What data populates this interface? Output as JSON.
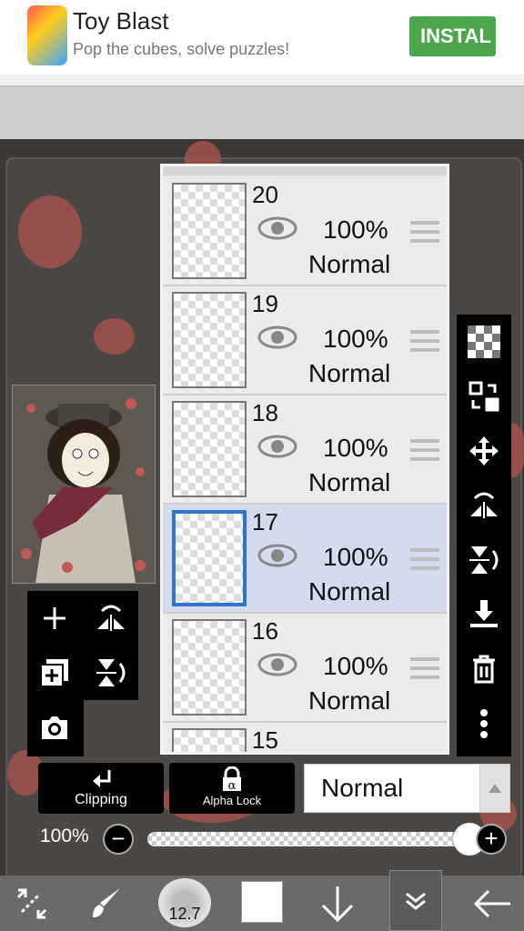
{
  "ad": {
    "title": "Toy Blast",
    "subtitle": "Pop the cubes, solve puzzles!",
    "button": "INSTAL"
  },
  "layers": [
    {
      "number": "20",
      "opacity": "100%",
      "blend": "Normal",
      "selected": false
    },
    {
      "number": "19",
      "opacity": "100%",
      "blend": "Normal",
      "selected": false
    },
    {
      "number": "18",
      "opacity": "100%",
      "blend": "Normal",
      "selected": false
    },
    {
      "number": "17",
      "opacity": "100%",
      "blend": "Normal",
      "selected": true
    },
    {
      "number": "16",
      "opacity": "100%",
      "blend": "Normal",
      "selected": false
    },
    {
      "number": "15"
    }
  ],
  "controls": {
    "clipping": "Clipping",
    "alpha_lock": "Alpha Lock",
    "blend_mode": "Normal",
    "opacity_label": "100%",
    "opacity_value": 1.0
  },
  "toolbar": {
    "brush_size": "12.7",
    "color": "#ffffff"
  },
  "icons": {
    "right_toolbar": [
      "transparency-icon",
      "layer-swap-icon",
      "move-icon",
      "flip-horizontal-icon",
      "flip-vertical-icon",
      "merge-down-icon",
      "trash-icon",
      "more-icon"
    ],
    "left_toolbar": [
      "add-layer-icon",
      "flip-icon",
      "duplicate-layer-icon",
      "flip-vertical-icon",
      "camera-icon"
    ],
    "navbar": [
      "transform-icon",
      "brush-icon",
      "brush-size",
      "color-swatch",
      "download-icon",
      "collapse-icon",
      "back-icon"
    ]
  }
}
